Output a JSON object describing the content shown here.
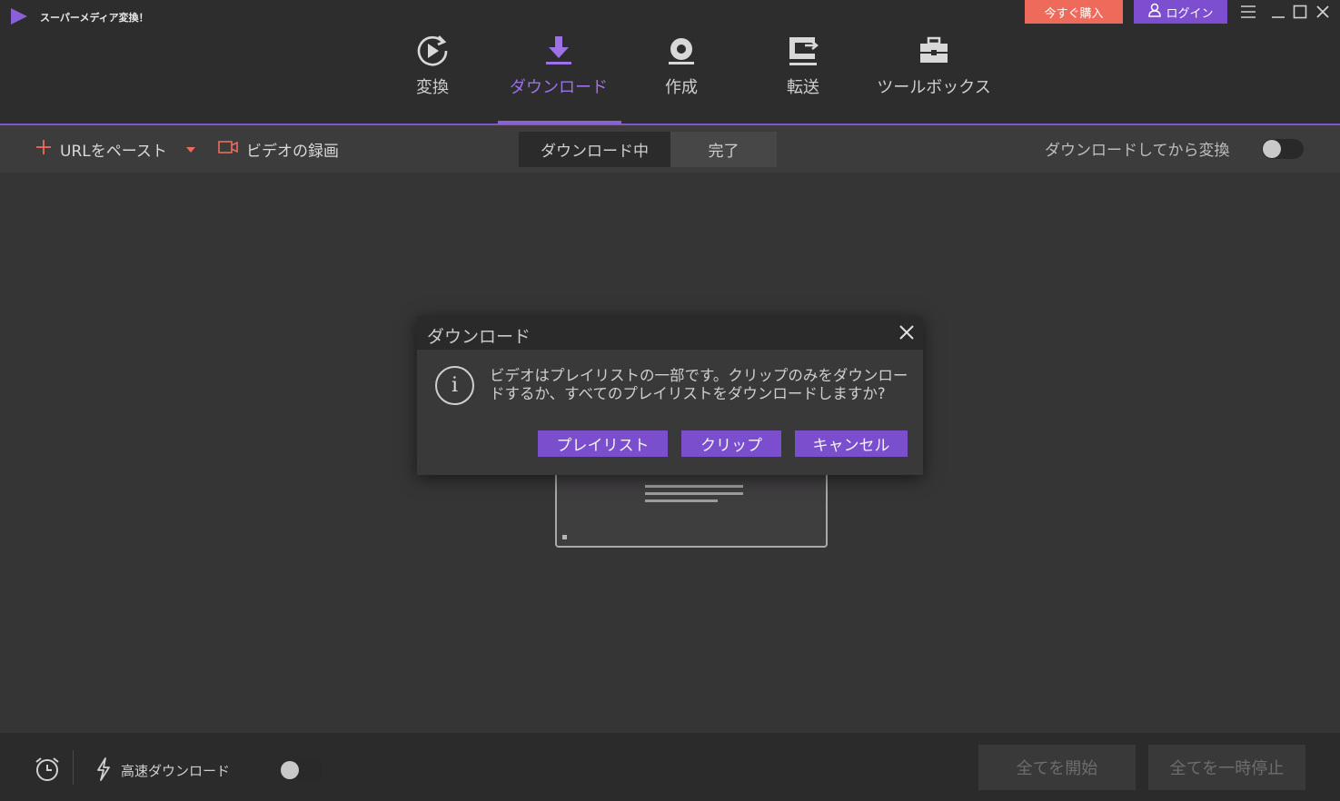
{
  "app": {
    "title": "スーパーメディア変換！"
  },
  "header": {
    "buy_label": "今すぐ購入",
    "login_label": "ログイン",
    "nav": [
      {
        "label": "変換",
        "icon": "convert-icon"
      },
      {
        "label": "ダウンロード",
        "icon": "download-icon"
      },
      {
        "label": "作成",
        "icon": "burn-disc-icon"
      },
      {
        "label": "転送",
        "icon": "transfer-icon"
      },
      {
        "label": "ツールボックス",
        "icon": "toolbox-icon"
      }
    ],
    "active_tab": "ダウンロード"
  },
  "toolbar": {
    "paste_url_label": "URLをペースト",
    "record_video_label": "ビデオの録画",
    "segments": [
      "ダウンロード中",
      "完了"
    ],
    "active_segment": "ダウンロード中",
    "convert_after_label": "ダウンロードしてから変換",
    "convert_after_enabled": false
  },
  "dialog": {
    "title": "ダウンロード",
    "message": "ビデオはプレイリストの一部です。クリップのみをダウンロードするか、すべてのプレイリストをダウンロードしますか?",
    "buttons": {
      "playlist": "プレイリスト",
      "clip": "クリップ",
      "cancel": "キャンセル"
    }
  },
  "bottom": {
    "fast_download_label": "高速ダウンロード",
    "fast_download_enabled": false,
    "start_all_label": "全てを開始",
    "pause_all_label": "全てを一時停止"
  },
  "colors": {
    "accent": "#7d4fd0",
    "buy": "#ee6b5c",
    "record_icon": "#ee6b5c",
    "background": "#363536"
  }
}
